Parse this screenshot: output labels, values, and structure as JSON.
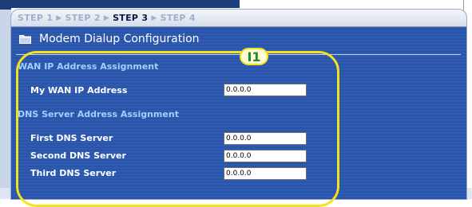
{
  "wizard": {
    "steps": [
      {
        "label": "STEP 1",
        "active": false
      },
      {
        "label": "STEP 2",
        "active": false
      },
      {
        "label": "STEP 3",
        "active": true
      },
      {
        "label": "STEP 4",
        "active": false
      }
    ],
    "title": "Modem Dialup Configuration"
  },
  "wan_section": {
    "heading": "WAN IP Address Assignment",
    "my_wan_ip": {
      "label": "My WAN IP Address",
      "value": "0.0.0.0"
    }
  },
  "dns_section": {
    "heading": "DNS Server Address Assignment",
    "first": {
      "label": "First DNS Server",
      "value": "0.0.0.0"
    },
    "second": {
      "label": "Second DNS Server",
      "value": "0.0.0.0"
    },
    "third": {
      "label": "Third DNS Server",
      "value": "0.0.0.0"
    }
  },
  "annotation": {
    "badge": "I1",
    "color": "#f2e21a"
  },
  "colors": {
    "panel_blue": "#2a54a8",
    "section_heading": "#9fd0ff",
    "active_step": "#0a1a44",
    "inactive_step": "#9fb0cf"
  }
}
